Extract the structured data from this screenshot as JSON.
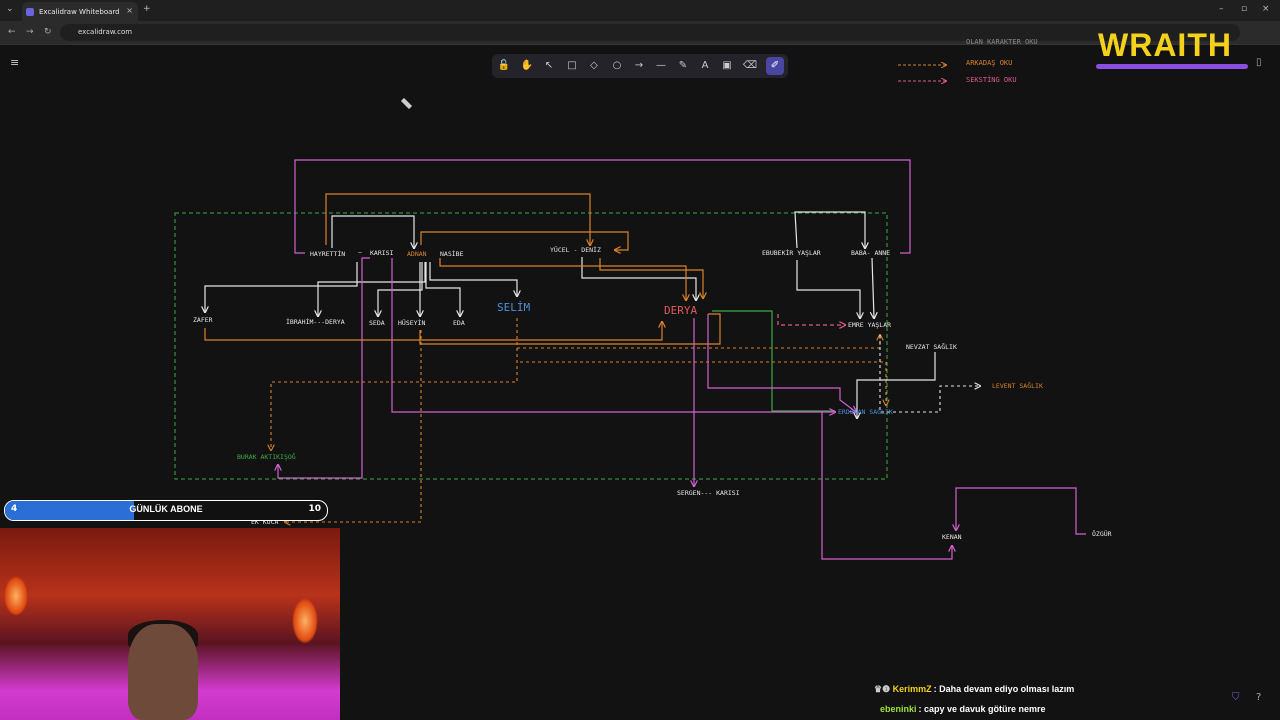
{
  "browser": {
    "tab_title": "Excalidraw Whiteboard",
    "url": "excalidraw.com",
    "new_tab": "+",
    "tab_close": "×",
    "window_controls": [
      "–",
      "▫",
      "×"
    ]
  },
  "toolbar": {
    "tools": [
      "lock-icon",
      "hand-icon",
      "selection-icon",
      "rectangle-icon",
      "diamond-icon",
      "ellipse-icon",
      "arrow-icon",
      "line-icon",
      "pencil-icon",
      "text-icon",
      "image-icon",
      "eraser-icon",
      "laser-icon"
    ],
    "glyphs": [
      "🔓",
      "✋",
      "↖",
      "□",
      "◇",
      "○",
      "→",
      "—",
      "✎",
      "A",
      "▣",
      "⌫",
      "✐"
    ],
    "active_tool": 12
  },
  "legend": {
    "top_cut": "OLAN KARAKTER OKU",
    "friend_arrow": "ARKADAŞ OKU",
    "sexting_arrow": "SEKSTİNG OKU",
    "friend_color": "#d9822b",
    "sexting_color": "#e05a8a"
  },
  "nodes": {
    "hayrettin": "HAYRETTİN",
    "karisi": "KARISI",
    "adnan": "ADNAN",
    "nasibe": "NASİBE",
    "yucel_deniz": "YÜCEL - DENİZ",
    "ebubekir": "EBUBEKİR YAŞLAR",
    "baba_anne": "BABA- ANNE",
    "zafer": "ZAFER",
    "ibrahim_derya": "İBRAHİM---DERYA",
    "seda": "SEDA",
    "huseyin": "HÜSEYİN",
    "eda": "EDA",
    "selim": "SELİM",
    "derya": "DERYA",
    "emre": "EMRE YAŞLAR",
    "nevzat": "NEVZAT SAĞLIK",
    "levent": "LEVENT SAĞLIK",
    "erdogan": "ERDOĞAN SAĞLIK",
    "burak": "BURAK AKTIKIŞOĞ",
    "sergen": "SERGEN--- KARISI",
    "ek_koca": "EK KOCA",
    "kenan": "KENAN",
    "ozgur": "ÖZGÜR"
  },
  "colors": {
    "white": "#e6e6e6",
    "orange": "#d9822b",
    "pink": "#d45fd0",
    "green": "#3fa845",
    "blue": "#4a90d9",
    "red": "#e05a5a",
    "canvas": "#121212"
  },
  "overlay": {
    "brand": "WRAITH",
    "brand_color": "#f4d21b",
    "sub_goal": {
      "title": "GÜNLÜK ABONE",
      "current": "4",
      "target": "10",
      "progress": 0.4
    }
  },
  "chat": [
    {
      "user": "KerimmZ",
      "message": ": Daha devam ediyo olması lazım",
      "color": "#f4d21b"
    },
    {
      "user": "ebeninki",
      "message": ": capy ve davuk götüre nemre",
      "color": "#9be03a"
    }
  ]
}
